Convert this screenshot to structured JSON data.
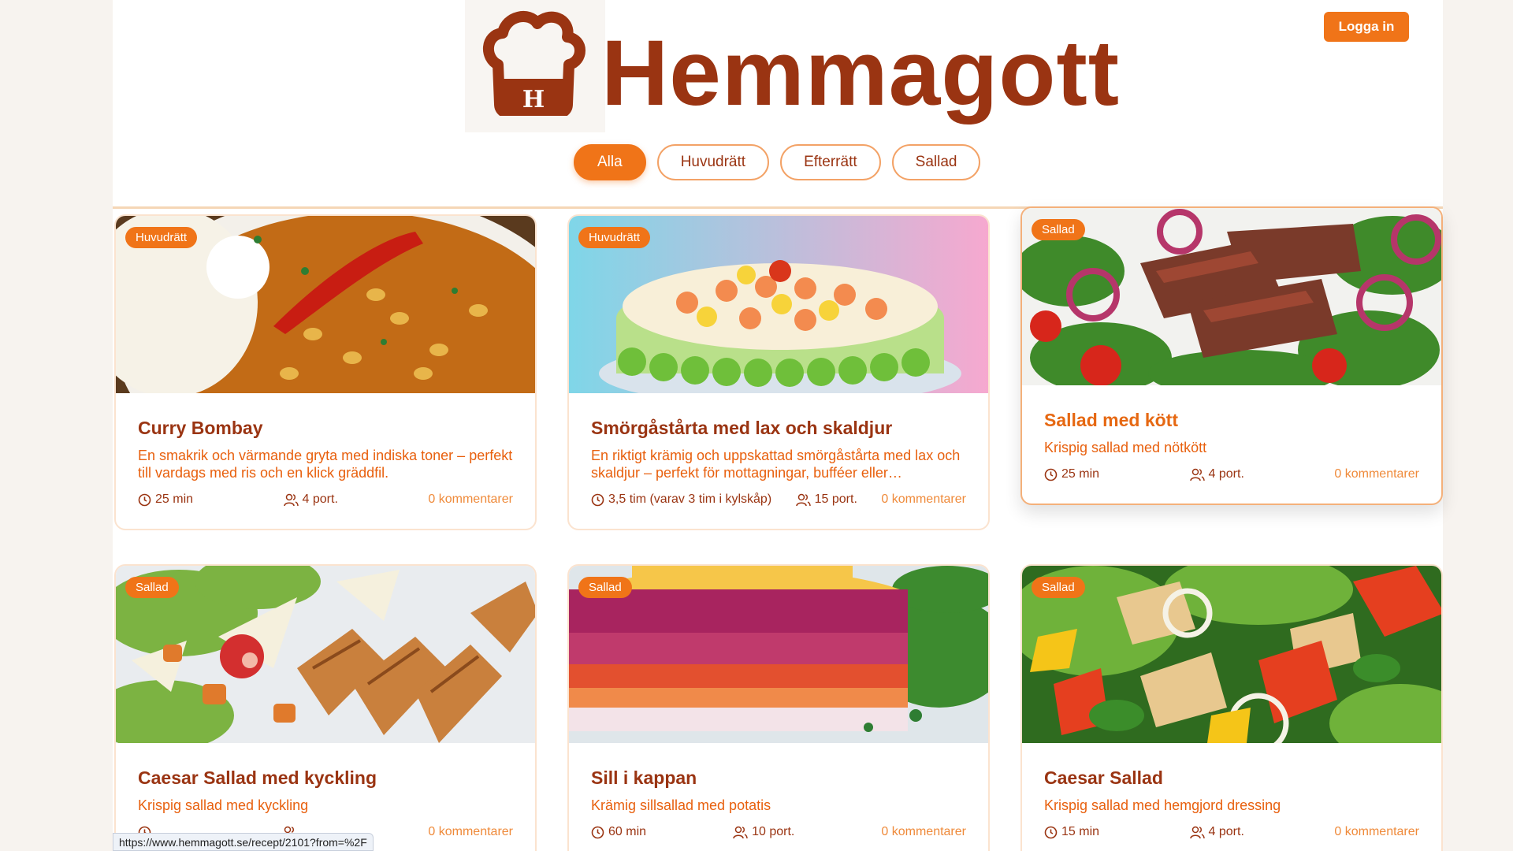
{
  "header": {
    "brand": "Hemmagott",
    "logo_letter": "H",
    "login_label": "Logga in"
  },
  "filters": [
    "Alla",
    "Huvudrätt",
    "Efterrätt",
    "Sallad"
  ],
  "active_filter": "Alla",
  "recipes": [
    {
      "category": "Huvudrätt",
      "title": "Curry Bombay",
      "description": "En smakrik och värmande gryta med indiska toner – perfekt till vardags med ris och en klick gräddfil.",
      "time": "25 min",
      "portions": "4 port.",
      "comments": "0 kommentarer",
      "image": "curry-bowl"
    },
    {
      "category": "Huvudrätt",
      "title": "Smörgåstårta med lax och skaldjur",
      "description": "En riktigt krämig och uppskattad smörgåstårta med lax och skaldjur – perfekt för mottagningar, bufféer eller…",
      "time": "3,5 tim (varav 3 tim i kylskåp)",
      "portions": "15 port.",
      "comments": "0 kommentarer",
      "image": "sandwich-cake"
    },
    {
      "category": "Sallad",
      "title": "Sallad med kött",
      "description": "Krispig sallad med nötkött",
      "time": "25 min",
      "portions": "4 port.",
      "comments": "0 kommentarer",
      "image": "beef-salad"
    },
    {
      "category": "Sallad",
      "title": "Caesar Sallad med kyckling",
      "description": "Krispig sallad med kyckling",
      "time": "",
      "portions": "",
      "comments": "0 kommentarer",
      "image": "chicken-caesar"
    },
    {
      "category": "Sallad",
      "title": "Sill i kappan",
      "description": "Krämig sillsallad med potatis",
      "time": "60 min",
      "portions": "10 port.",
      "comments": "0 kommentarer",
      "image": "herring-salad"
    },
    {
      "category": "Sallad",
      "title": "Caesar Sallad",
      "description": "Krispig sallad med hemgjord dressing",
      "time": "15 min",
      "portions": "4 port.",
      "comments": "0 kommentarer",
      "image": "caesar-salad"
    }
  ],
  "status_bar": {
    "url": "https://www.hemmagott.se/recept/2101?from=%2F"
  },
  "colors": {
    "brand": "#9a3412",
    "accent": "#f07418"
  }
}
